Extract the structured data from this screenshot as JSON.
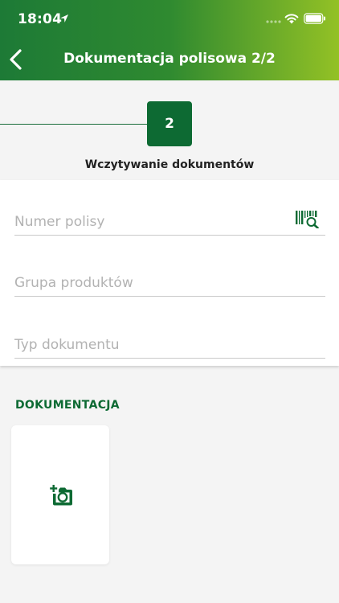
{
  "status_bar": {
    "time": "18:04"
  },
  "header": {
    "title": "Dokumentacja polisowa 2/2",
    "back_icon": "chevron-left-icon"
  },
  "stepper": {
    "step_number": "2",
    "step_label": "Wczytywanie dokumentów"
  },
  "form": {
    "fields": [
      {
        "placeholder": "Numer polisy",
        "value": "",
        "icon": "barcode-scan-icon"
      },
      {
        "placeholder": "Grupa produktów",
        "value": ""
      },
      {
        "placeholder": "Typ dokumentu",
        "value": ""
      }
    ]
  },
  "documents": {
    "section_title": "DOKUMENTACJA",
    "add_icon": "add-photo-icon"
  },
  "colors": {
    "brand_green": "#0d6a33",
    "header_gradient_start": "#1d7a36",
    "header_gradient_end": "#93c125",
    "background": "#f4f4f4"
  }
}
